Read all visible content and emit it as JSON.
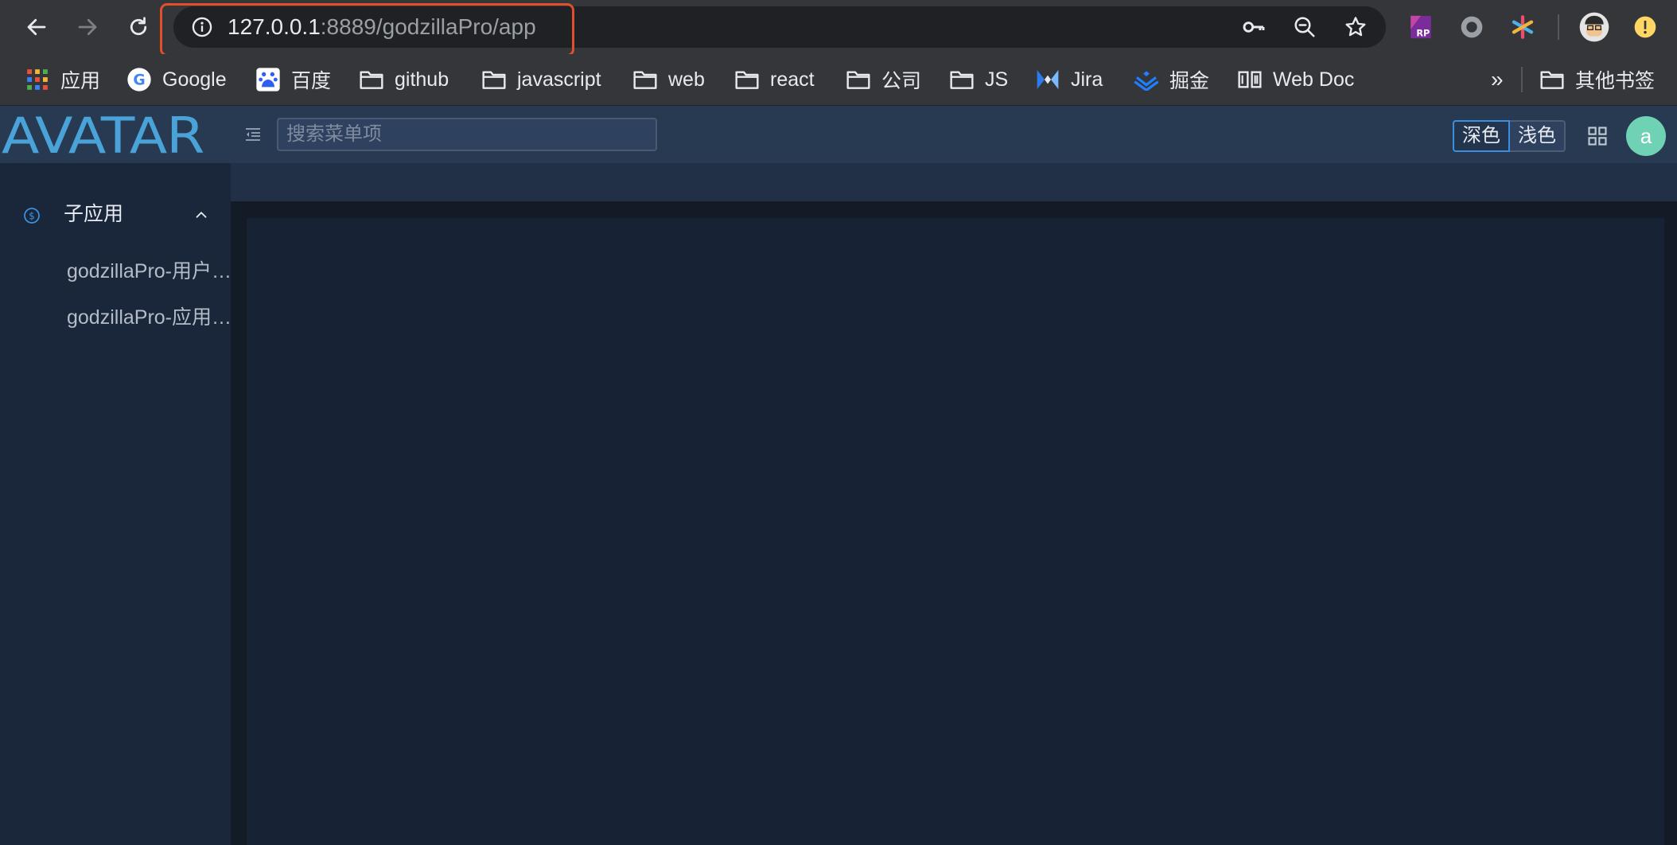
{
  "browser": {
    "url_host": "127.0.0.1",
    "url_path": ":8889/godzillaPro/app",
    "bookmarks": [
      {
        "label": "应用",
        "icon": "apps-grid-icon"
      },
      {
        "label": "Google",
        "icon": "google-icon"
      },
      {
        "label": "百度",
        "icon": "baidu-icon"
      },
      {
        "label": "github",
        "icon": "folder-icon"
      },
      {
        "label": "javascript",
        "icon": "folder-icon"
      },
      {
        "label": "web",
        "icon": "folder-icon"
      },
      {
        "label": "react",
        "icon": "folder-icon"
      },
      {
        "label": "公司",
        "icon": "folder-icon"
      },
      {
        "label": "JS",
        "icon": "folder-icon"
      },
      {
        "label": "Jira",
        "icon": "jira-icon"
      },
      {
        "label": "掘金",
        "icon": "juejin-icon"
      },
      {
        "label": "Web Doc",
        "icon": "webdoc-icon"
      }
    ],
    "overflow_label": "»",
    "other_bookmarks": "其他书签"
  },
  "app": {
    "logo": "AVATAR",
    "search_placeholder": "搜索菜单项",
    "theme_dark": "深色",
    "theme_light": "浅色",
    "avatar_letter": "a",
    "accent": "#3a8fe0",
    "sidebar": {
      "submenu_title": "子应用",
      "items": [
        "godzillaPro-用户…",
        "godzillaPro-应用…"
      ]
    }
  }
}
